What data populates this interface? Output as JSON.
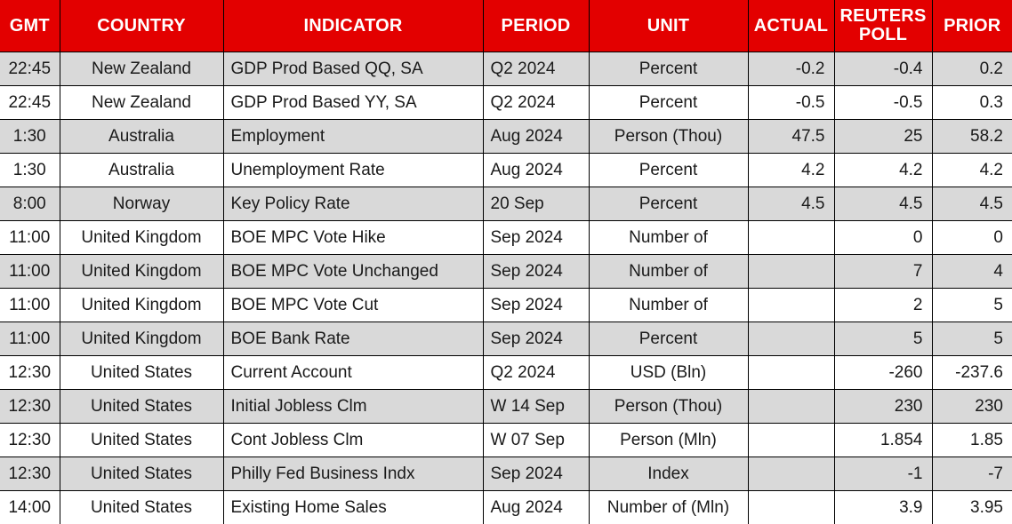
{
  "table": {
    "columns": [
      {
        "key": "gmt",
        "label": "GMT",
        "align": "center"
      },
      {
        "key": "country",
        "label": "COUNTRY",
        "align": "center"
      },
      {
        "key": "indicator",
        "label": "INDICATOR",
        "align": "left"
      },
      {
        "key": "period",
        "label": "PERIOD",
        "align": "left"
      },
      {
        "key": "unit",
        "label": "UNIT",
        "align": "center"
      },
      {
        "key": "actual",
        "label": "ACTUAL",
        "align": "right"
      },
      {
        "key": "poll",
        "label": "REUTERS POLL",
        "align": "right"
      },
      {
        "key": "prior",
        "label": "PRIOR",
        "align": "right"
      }
    ],
    "header_bg": "#E30000",
    "header_fg": "#FFFFFF",
    "row_alt_bg": "#D9D9D9",
    "row_bg": "#FFFFFF",
    "rows": [
      {
        "gmt": "22:45",
        "country": "New Zealand",
        "indicator": "GDP Prod Based QQ, SA",
        "period": "Q2 2024",
        "unit": "Percent",
        "actual": "-0.2",
        "poll": "-0.4",
        "prior": "0.2"
      },
      {
        "gmt": "22:45",
        "country": "New Zealand",
        "indicator": "GDP Prod Based YY, SA",
        "period": "Q2 2024",
        "unit": "Percent",
        "actual": "-0.5",
        "poll": "-0.5",
        "prior": "0.3"
      },
      {
        "gmt": "1:30",
        "country": "Australia",
        "indicator": "Employment",
        "period": "Aug 2024",
        "unit": "Person (Thou)",
        "actual": "47.5",
        "poll": "25",
        "prior": "58.2"
      },
      {
        "gmt": "1:30",
        "country": "Australia",
        "indicator": "Unemployment Rate",
        "period": "Aug 2024",
        "unit": "Percent",
        "actual": "4.2",
        "poll": "4.2",
        "prior": "4.2"
      },
      {
        "gmt": "8:00",
        "country": "Norway",
        "indicator": "Key Policy Rate",
        "period": "20 Sep",
        "unit": "Percent",
        "actual": "4.5",
        "poll": "4.5",
        "prior": "4.5"
      },
      {
        "gmt": "11:00",
        "country": "United Kingdom",
        "indicator": "BOE MPC Vote Hike",
        "period": "Sep 2024",
        "unit": "Number of",
        "actual": "",
        "poll": "0",
        "prior": "0"
      },
      {
        "gmt": "11:00",
        "country": "United Kingdom",
        "indicator": "BOE MPC Vote Unchanged",
        "period": "Sep 2024",
        "unit": "Number of",
        "actual": "",
        "poll": "7",
        "prior": "4"
      },
      {
        "gmt": "11:00",
        "country": "United Kingdom",
        "indicator": "BOE MPC Vote Cut",
        "period": "Sep 2024",
        "unit": "Number of",
        "actual": "",
        "poll": "2",
        "prior": "5"
      },
      {
        "gmt": "11:00",
        "country": "United Kingdom",
        "indicator": "BOE Bank Rate",
        "period": "Sep 2024",
        "unit": "Percent",
        "actual": "",
        "poll": "5",
        "prior": "5"
      },
      {
        "gmt": "12:30",
        "country": "United States",
        "indicator": "Current Account",
        "period": "Q2 2024",
        "unit": "USD (Bln)",
        "actual": "",
        "poll": "-260",
        "prior": "-237.6"
      },
      {
        "gmt": "12:30",
        "country": "United States",
        "indicator": "Initial Jobless Clm",
        "period": "W 14 Sep",
        "unit": "Person (Thou)",
        "actual": "",
        "poll": "230",
        "prior": "230"
      },
      {
        "gmt": "12:30",
        "country": "United States",
        "indicator": "Cont Jobless Clm",
        "period": "W 07 Sep",
        "unit": "Person (Mln)",
        "actual": "",
        "poll": "1.854",
        "prior": "1.85"
      },
      {
        "gmt": "12:30",
        "country": "United States",
        "indicator": "Philly Fed Business Indx",
        "period": "Sep 2024",
        "unit": "Index",
        "actual": "",
        "poll": "-1",
        "prior": "-7"
      },
      {
        "gmt": "14:00",
        "country": "United States",
        "indicator": "Existing Home Sales",
        "period": "Aug 2024",
        "unit": "Number of (Mln)",
        "actual": "",
        "poll": "3.9",
        "prior": "3.95"
      }
    ]
  }
}
